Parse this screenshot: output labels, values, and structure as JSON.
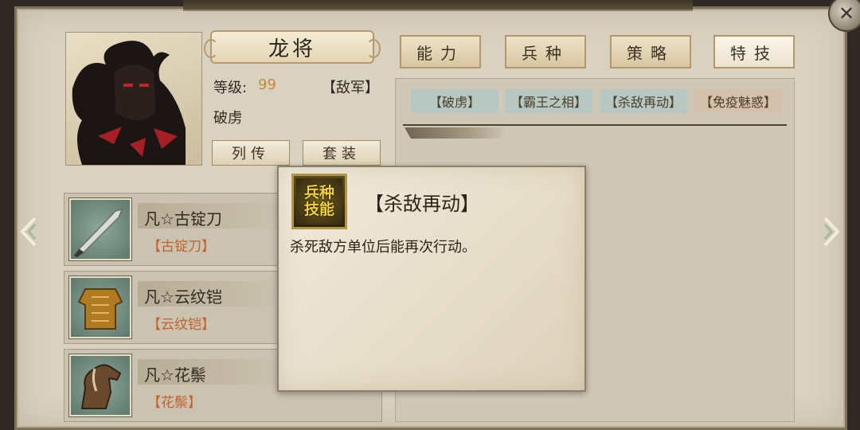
{
  "hero": {
    "name": "龙将",
    "level_label": "等级:",
    "level_value": "99",
    "faction": "【敌军】",
    "subtitle": "破虏",
    "buttons": [
      "列传",
      "套装"
    ]
  },
  "tabs": [
    "能力",
    "兵种",
    "策略",
    "特技"
  ],
  "active_tab_index": 3,
  "skills": [
    {
      "label": "【破虏】",
      "bg": "#b7c8c2"
    },
    {
      "label": "【霸王之相】",
      "bg": "#b7c8c2"
    },
    {
      "label": "【杀敌再动】",
      "bg": "#b7c8c2"
    },
    {
      "label": "【免疫魅惑】",
      "bg": "#d4c0ac"
    }
  ],
  "equipment": [
    {
      "name": "凡☆古锭刀",
      "sub": "【古锭刀】",
      "icon": "blade-icon"
    },
    {
      "name": "凡☆云纹铠",
      "sub": "【云纹铠】",
      "icon": "armor-icon"
    },
    {
      "name": "凡☆花鬃",
      "sub": "【花鬃】",
      "icon": "horse-icon"
    }
  ],
  "popup": {
    "icon_text": [
      "兵种",
      "技能"
    ],
    "title": "【杀敌再动】",
    "description": "杀死敌方单位后能再次行动。"
  },
  "colors": {
    "accent_orange": "#c98a3a",
    "sub_orange": "#c2632b",
    "icon_gold": "#f1cf39",
    "panel_bg": "#d9d2c1"
  }
}
